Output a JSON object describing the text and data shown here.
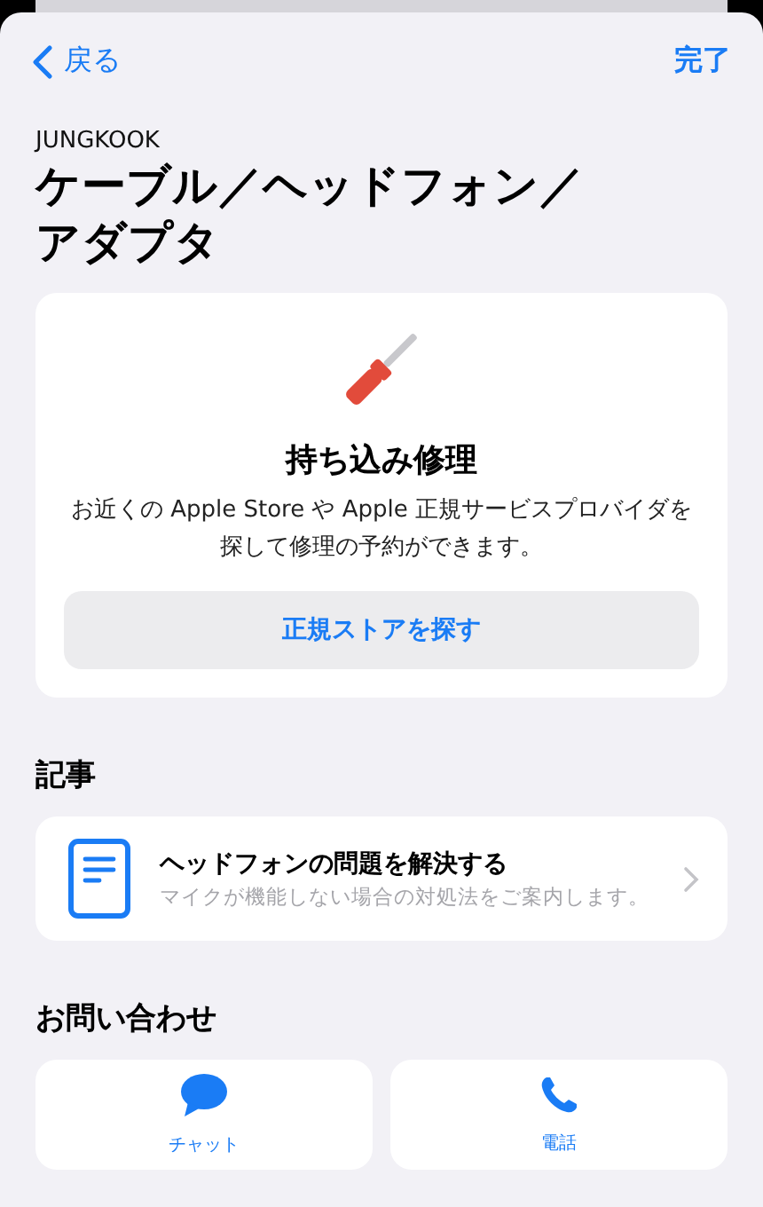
{
  "nav": {
    "back": "戻る",
    "done": "完了"
  },
  "header": {
    "subtitle": "JUNGKOOK",
    "title_lines": [
      "ケーブル／ヘッドフォン／",
      "アダプタ"
    ]
  },
  "repair_card": {
    "title": "持ち込み修理",
    "description": "お近くの Apple Store や Apple 正規サービスプロバイダを探して修理の予約ができます。",
    "button": "正規ストアを探す"
  },
  "articles": {
    "heading": "記事",
    "items": [
      {
        "title": "ヘッドフォンの問題を解決する",
        "subtitle": "マイクが機能しない場合の対処法をご案内します。"
      }
    ]
  },
  "contact": {
    "heading": "お問い合わせ",
    "items": [
      {
        "kind": "chat",
        "label": "チャット"
      },
      {
        "kind": "phone",
        "label": "電話"
      }
    ]
  }
}
